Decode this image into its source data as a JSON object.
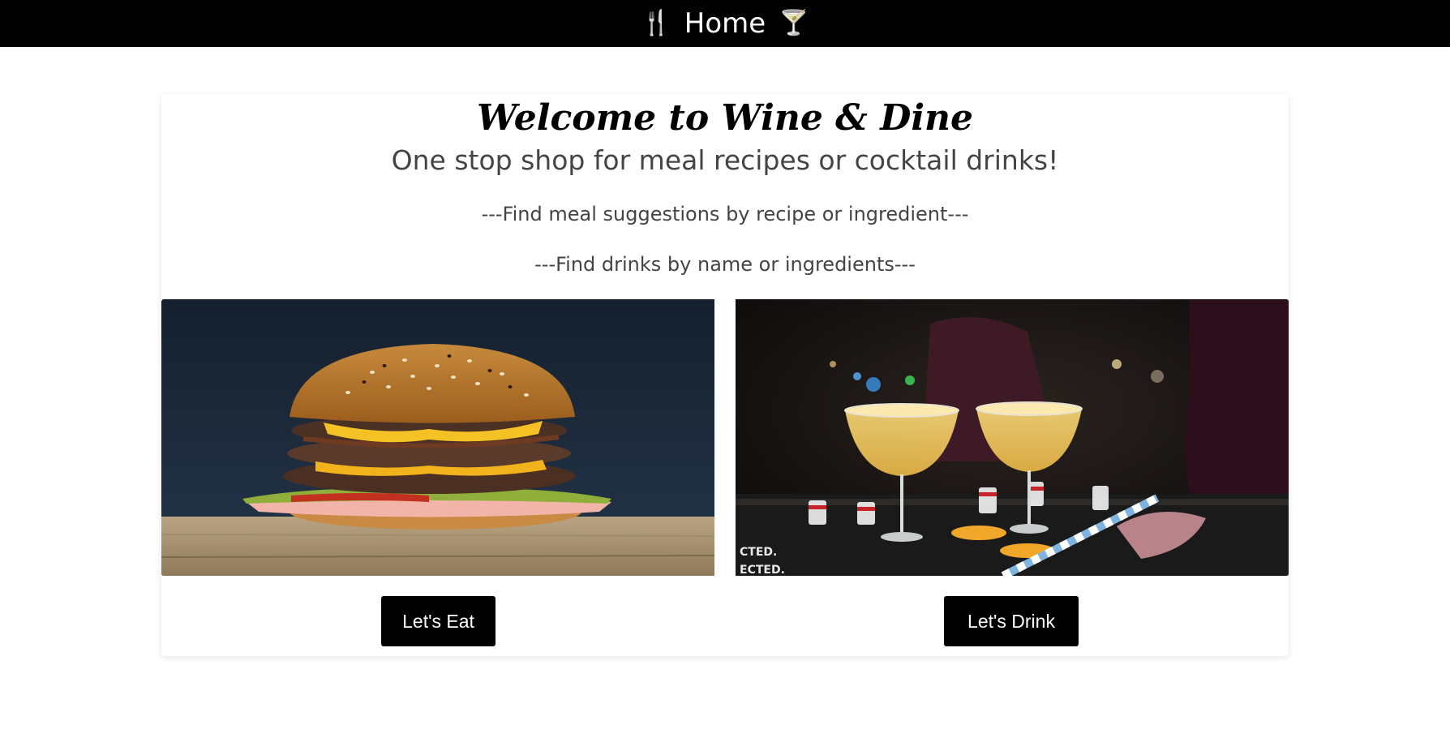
{
  "nav": {
    "left_icon": "🍴",
    "title": "Home",
    "right_icon": "🍸",
    "icons": [
      "fork-and-knife-icon",
      "cocktail-glass-icon"
    ]
  },
  "hero": {
    "title": "Welcome to Wine & Dine",
    "tagline": "One stop shop for meal recipes or cocktail drinks!",
    "line1": "---Find meal suggestions by recipe or ingredient---",
    "line2": "---Find drinks by name or ingredients---"
  },
  "cards": {
    "eat_button": "Let's Eat",
    "drink_button": "Let's Drink"
  },
  "colors": {
    "topbar": "#000000",
    "button": "#000000",
    "text_muted": "#444444"
  }
}
